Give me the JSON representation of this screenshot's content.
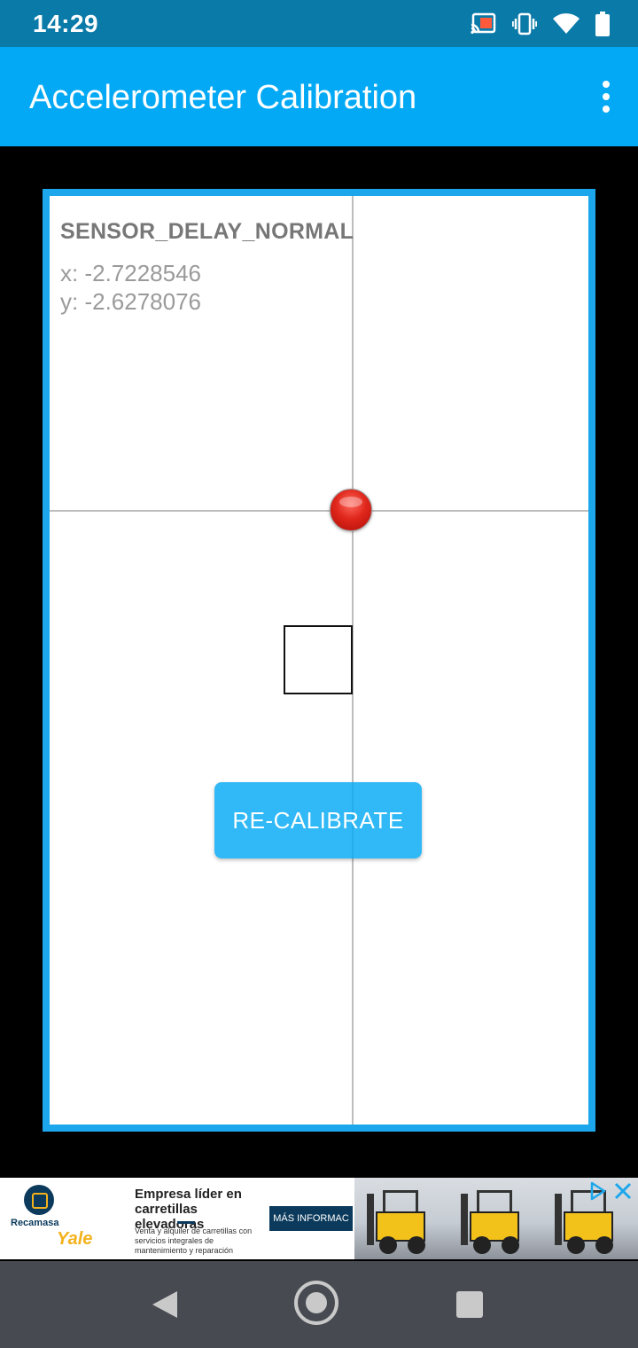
{
  "status_bar": {
    "time": "14:29",
    "icons": [
      "cast-icon",
      "vibrate-icon",
      "wifi-icon",
      "battery-icon"
    ]
  },
  "app_bar": {
    "title": "Accelerometer Calibration",
    "overflow_icon": "more-vert-icon"
  },
  "calibration": {
    "mode": "SENSOR_DELAY_NORMAL",
    "x_reading": "x: -2.7228546",
    "y_reading": "y: -2.6278076",
    "recalibrate_label": "RE-CALIBRATE"
  },
  "ad": {
    "brand": "Recamasa",
    "brand2": "Yale",
    "headline": "Empresa líder en carretillas elevadoras",
    "body": "Venta y alquiler de carretillas con servicios integrales de mantenimiento y reparación",
    "cta": "MÁS INFORMAC",
    "choices_icons": [
      "adchoices-icon",
      "close-icon"
    ]
  },
  "nav_bar": {
    "icons": [
      "back-icon",
      "home-icon",
      "recents-icon"
    ]
  },
  "colors": {
    "status_bar": "#0a7aa8",
    "app_bar": "#03a9f4",
    "board_border": "#1ca7ec",
    "ball": "#e0271c",
    "button": "#03a9f4",
    "nav_bar": "#474b51"
  }
}
